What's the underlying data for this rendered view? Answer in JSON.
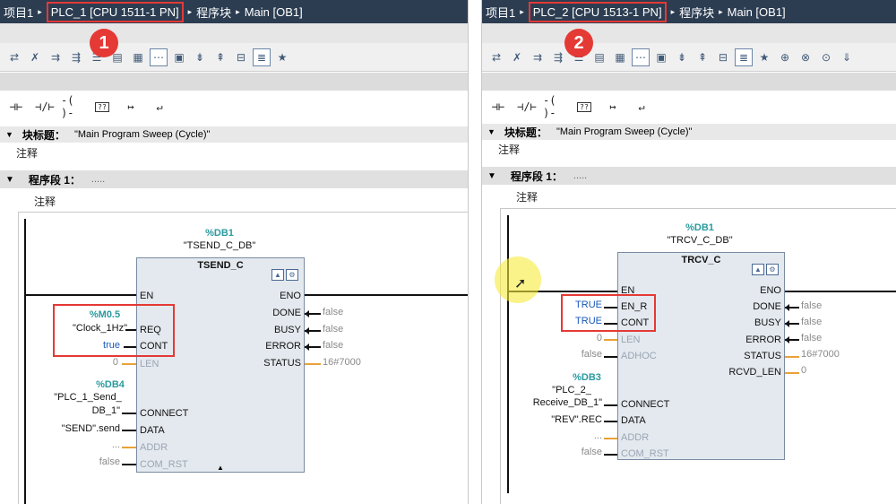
{
  "panels": [
    {
      "breadcrumb": {
        "project": "项目1",
        "plc": "PLC_1 [CPU 1511-1 PN]",
        "blocks": "程序块",
        "main": "Main [OB1]"
      },
      "step": "1",
      "block_title": {
        "label": "块标题：",
        "value": "\"Main Program Sweep (Cycle)\""
      },
      "comment": "注释",
      "network": {
        "label": "程序段 1：",
        "dots": "....."
      },
      "network_comment": "注释",
      "db": {
        "address": "%DB1",
        "name": "\"TSEND_C_DB\""
      },
      "fb": {
        "title": "TSEND_C",
        "inputs": [
          "EN",
          "REQ",
          "CONT",
          "LEN",
          "CONNECT",
          "DATA",
          "ADDR",
          "COM_RST"
        ],
        "outputs": [
          "ENO",
          "DONE",
          "BUSY",
          "ERROR",
          "STATUS"
        ]
      },
      "params_in": {
        "req_addr": "%M0.5",
        "req_name": "\"Clock_1Hz\"",
        "cont": "true",
        "len": "0",
        "connect_addr": "%DB4",
        "connect_name_1": "\"PLC_1_Send_",
        "connect_name_2": "DB_1\"",
        "data": "\"SEND\".send",
        "addr": "...",
        "com_rst": "false"
      },
      "params_out": {
        "done": "false",
        "busy": "false",
        "error": "false",
        "status": "16#7000"
      }
    },
    {
      "breadcrumb": {
        "project": "项目1",
        "plc": "PLC_2 [CPU 1513-1 PN]",
        "blocks": "程序块",
        "main": "Main [OB1]"
      },
      "step": "2",
      "block_title": {
        "label": "块标题：",
        "value": "\"Main Program Sweep (Cycle)\""
      },
      "comment": "注释",
      "network": {
        "label": "程序段 1：",
        "dots": "....."
      },
      "network_comment": "注释",
      "db": {
        "address": "%DB1",
        "name": "\"TRCV_C_DB\""
      },
      "fb": {
        "title": "TRCV_C",
        "inputs": [
          "EN",
          "EN_R",
          "CONT",
          "LEN",
          "ADHOC",
          "CONNECT",
          "DATA",
          "ADDR",
          "COM_RST"
        ],
        "outputs": [
          "ENO",
          "DONE",
          "BUSY",
          "ERROR",
          "STATUS",
          "RCVD_LEN"
        ]
      },
      "params_in": {
        "en_r": "TRUE",
        "cont": "TRUE",
        "len": "0",
        "adhoc": "false",
        "connect_addr": "%DB3",
        "connect_name_1": "\"PLC_2_",
        "connect_name_2": "Receive_DB_1\"",
        "data": "\"REV\".REC",
        "addr": "...",
        "com_rst": "false"
      },
      "params_out": {
        "done": "false",
        "busy": "false",
        "error": "false",
        "status": "16#7000",
        "rcvd_len": "0"
      }
    }
  ],
  "toolbar": {
    "icons": [
      "insert-network-icon",
      "delete-network-icon",
      "insert-row-icon",
      "append-row-icon",
      "list-icon",
      "table-icon",
      "block-icon",
      "comment-icon",
      "monitor-icon",
      "ladder-down-icon",
      "ladder-up-icon",
      "box-icon",
      "favorites-icon",
      "watch-icon",
      "stop-icon",
      "go-icon",
      "download-icon",
      "filter-icon"
    ]
  },
  "ladder_toolbar": {
    "no_contact": "⊣⊢",
    "nc_contact": "⊣/⊢",
    "coil": "-( )-",
    "empty_box": "??",
    "open_branch": "↦",
    "close_branch": "↵"
  }
}
